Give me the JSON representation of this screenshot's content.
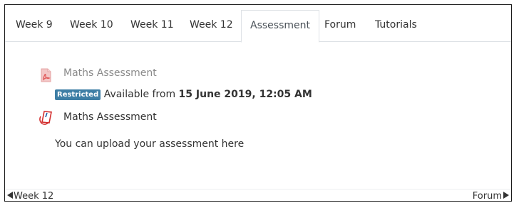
{
  "tabs": [
    {
      "label": "Week 9"
    },
    {
      "label": "Week 10"
    },
    {
      "label": "Week 11"
    },
    {
      "label": "Week 12"
    },
    {
      "label": "Assessment",
      "active": true
    },
    {
      "label": "Forum"
    },
    {
      "label": "Tutorials"
    }
  ],
  "resource": {
    "title": "Maths Assessment",
    "icon": "pdf-file-icon",
    "restriction_badge": "Restricted",
    "availability_prefix": "Available from",
    "availability_date": "15 June 2019, 12:05 AM"
  },
  "assignment": {
    "title": "Maths Assessment",
    "icon": "assignment-upload-icon",
    "description": "You can upload your assessment here"
  },
  "navigation": {
    "prev_label": "Week 12",
    "next_label": "Forum"
  },
  "colors": {
    "badge": "#3e7ea5",
    "pdf_red": "#e05a5a",
    "assign_red": "#d32f2f",
    "dim_text": "#8a8a8a"
  }
}
